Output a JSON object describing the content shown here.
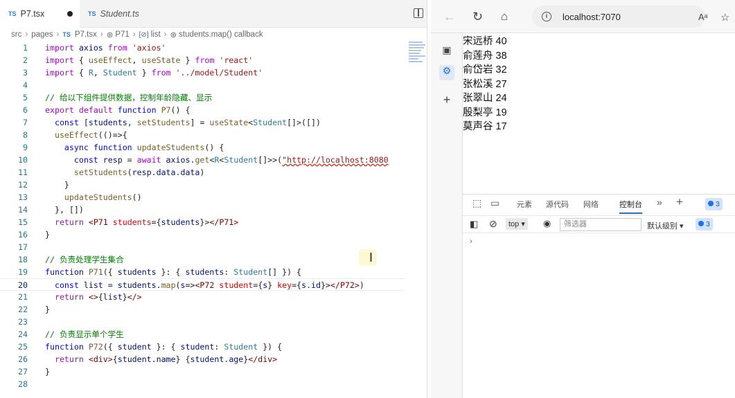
{
  "editor": {
    "tabs": [
      {
        "label": "P7.tsx",
        "badge": "TS"
      },
      {
        "label": "Student.ts",
        "badge": "TS"
      }
    ],
    "breadcrumb": [
      "src",
      "pages",
      "P7.tsx",
      "P71",
      "list",
      "students.map() callback"
    ],
    "breadcrumb_badges": {
      "tsx": "TS",
      "list": "[⊘]"
    },
    "lines": [
      {
        "n": "1"
      },
      {
        "n": "2"
      },
      {
        "n": "3"
      },
      {
        "n": "4"
      },
      {
        "n": "5"
      },
      {
        "n": "6"
      },
      {
        "n": "7"
      },
      {
        "n": "8"
      },
      {
        "n": "9"
      },
      {
        "n": "10"
      },
      {
        "n": "11"
      },
      {
        "n": "12"
      },
      {
        "n": "13"
      },
      {
        "n": "14"
      },
      {
        "n": "15"
      },
      {
        "n": "16"
      },
      {
        "n": "17"
      },
      {
        "n": "18"
      },
      {
        "n": "19"
      },
      {
        "n": "20"
      },
      {
        "n": "21"
      },
      {
        "n": "22"
      },
      {
        "n": "23"
      },
      {
        "n": "24"
      },
      {
        "n": "25"
      },
      {
        "n": "26"
      },
      {
        "n": "27"
      },
      {
        "n": "28"
      }
    ],
    "current_line": 20
  },
  "browser": {
    "address": "localhost:7070",
    "students": [
      "宋远桥 40",
      "俞莲舟 38",
      "俞岱岩 32",
      "张松溪 27",
      "张翠山 24",
      "殷梨亭 19",
      "莫声谷 17"
    ],
    "devtools": {
      "tabs": [
        "元素",
        "源代码",
        "网络",
        "控制台"
      ],
      "active_tab": "控制台",
      "issue_count": "3",
      "context": "top",
      "filter_placeholder": "筛选器",
      "level": "默认级别",
      "level_count": "3",
      "prompt": "›"
    }
  },
  "colors": {
    "keyword": "#0000ff",
    "string": "#a31515",
    "comment": "#008000",
    "type": "#267f99",
    "accent": "#1a73e8"
  }
}
